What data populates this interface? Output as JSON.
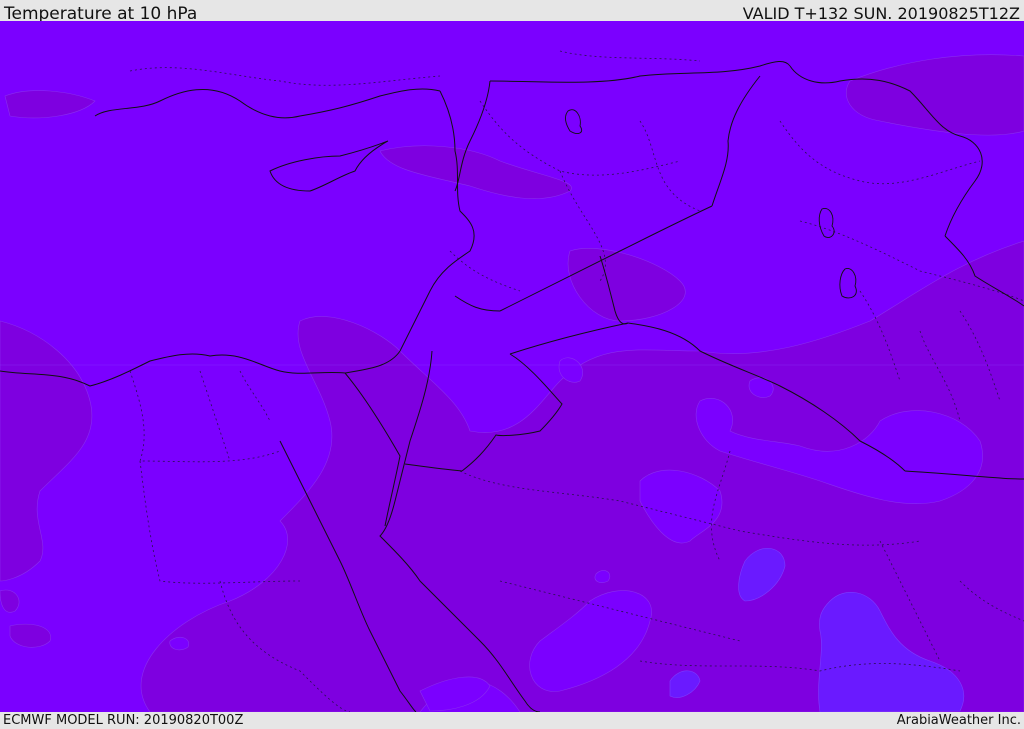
{
  "header": {
    "title": "Temperature at 10 hPa",
    "valid": "VALID T+132 SUN. 20190825T12Z"
  },
  "footer": {
    "model_run": "ECMWF MODEL RUN: 20190820T00Z",
    "credit": "ArabiaWeather Inc."
  },
  "map": {
    "colors": {
      "base_field": "#7b00ff",
      "warmer_band": "#7e00e0",
      "cooler_band": "#6a1aff",
      "borders": "#111111"
    }
  }
}
